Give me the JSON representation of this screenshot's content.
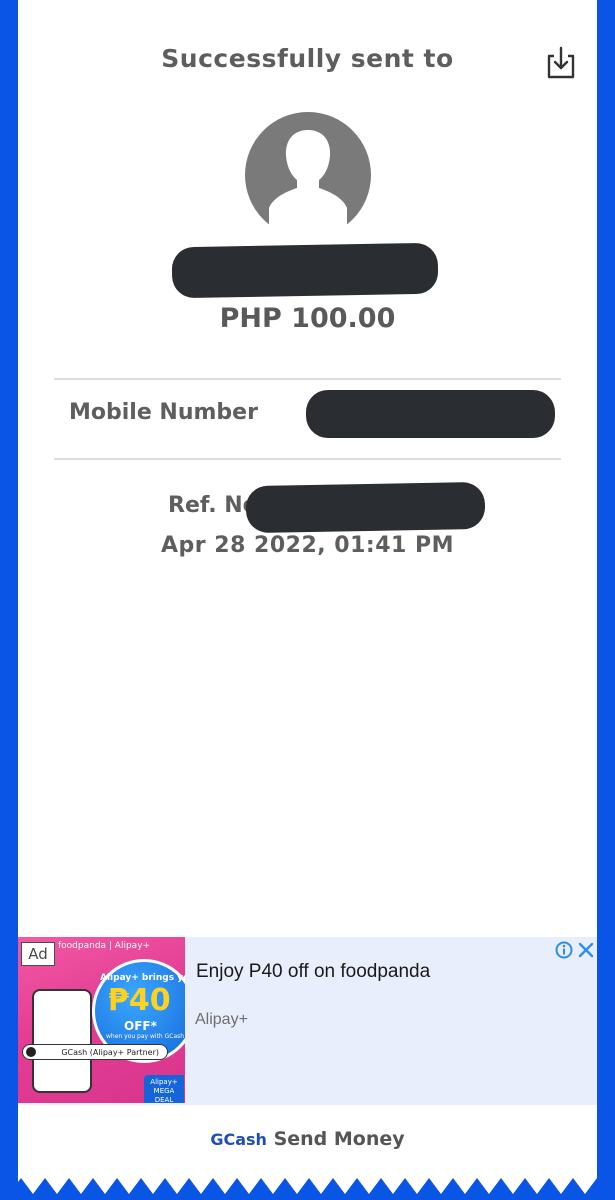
{
  "header": {
    "title": "Successfully sent to",
    "download_icon": "download-icon"
  },
  "recipient": {
    "avatar_icon": "default-avatar-icon",
    "name": "[redacted]",
    "amount": "PHP 100.00"
  },
  "details": {
    "mobile_label": "Mobile Number",
    "mobile_value": "[redacted]",
    "ref_label": "Ref. No",
    "ref_value": "[redacted]",
    "datetime": "Apr 28 2022, 01:41 PM"
  },
  "ad": {
    "badge": "Ad",
    "headline": "Enjoy P40 off on foodpanda",
    "advertiser": "Alipay+",
    "image_texts": {
      "brand_line": "foodpanda | Alipay+",
      "promo_brand": "Alipay+ brings you",
      "promo_amount": "₱40",
      "promo_off": "OFF*",
      "promo_sub": "when you pay with GCash",
      "partner": "GCash (Alipay+ Partner)",
      "deal": "Alipay+ MEGA DEAL"
    }
  },
  "footer": {
    "brand": "GCash",
    "label": "Send Money"
  },
  "colors": {
    "frame": "#0a55e6",
    "redaction": "#2a2e32",
    "text": "#5e5e5e",
    "ad_background": "#e8eefb",
    "brand_blue": "#1d4fb5"
  }
}
